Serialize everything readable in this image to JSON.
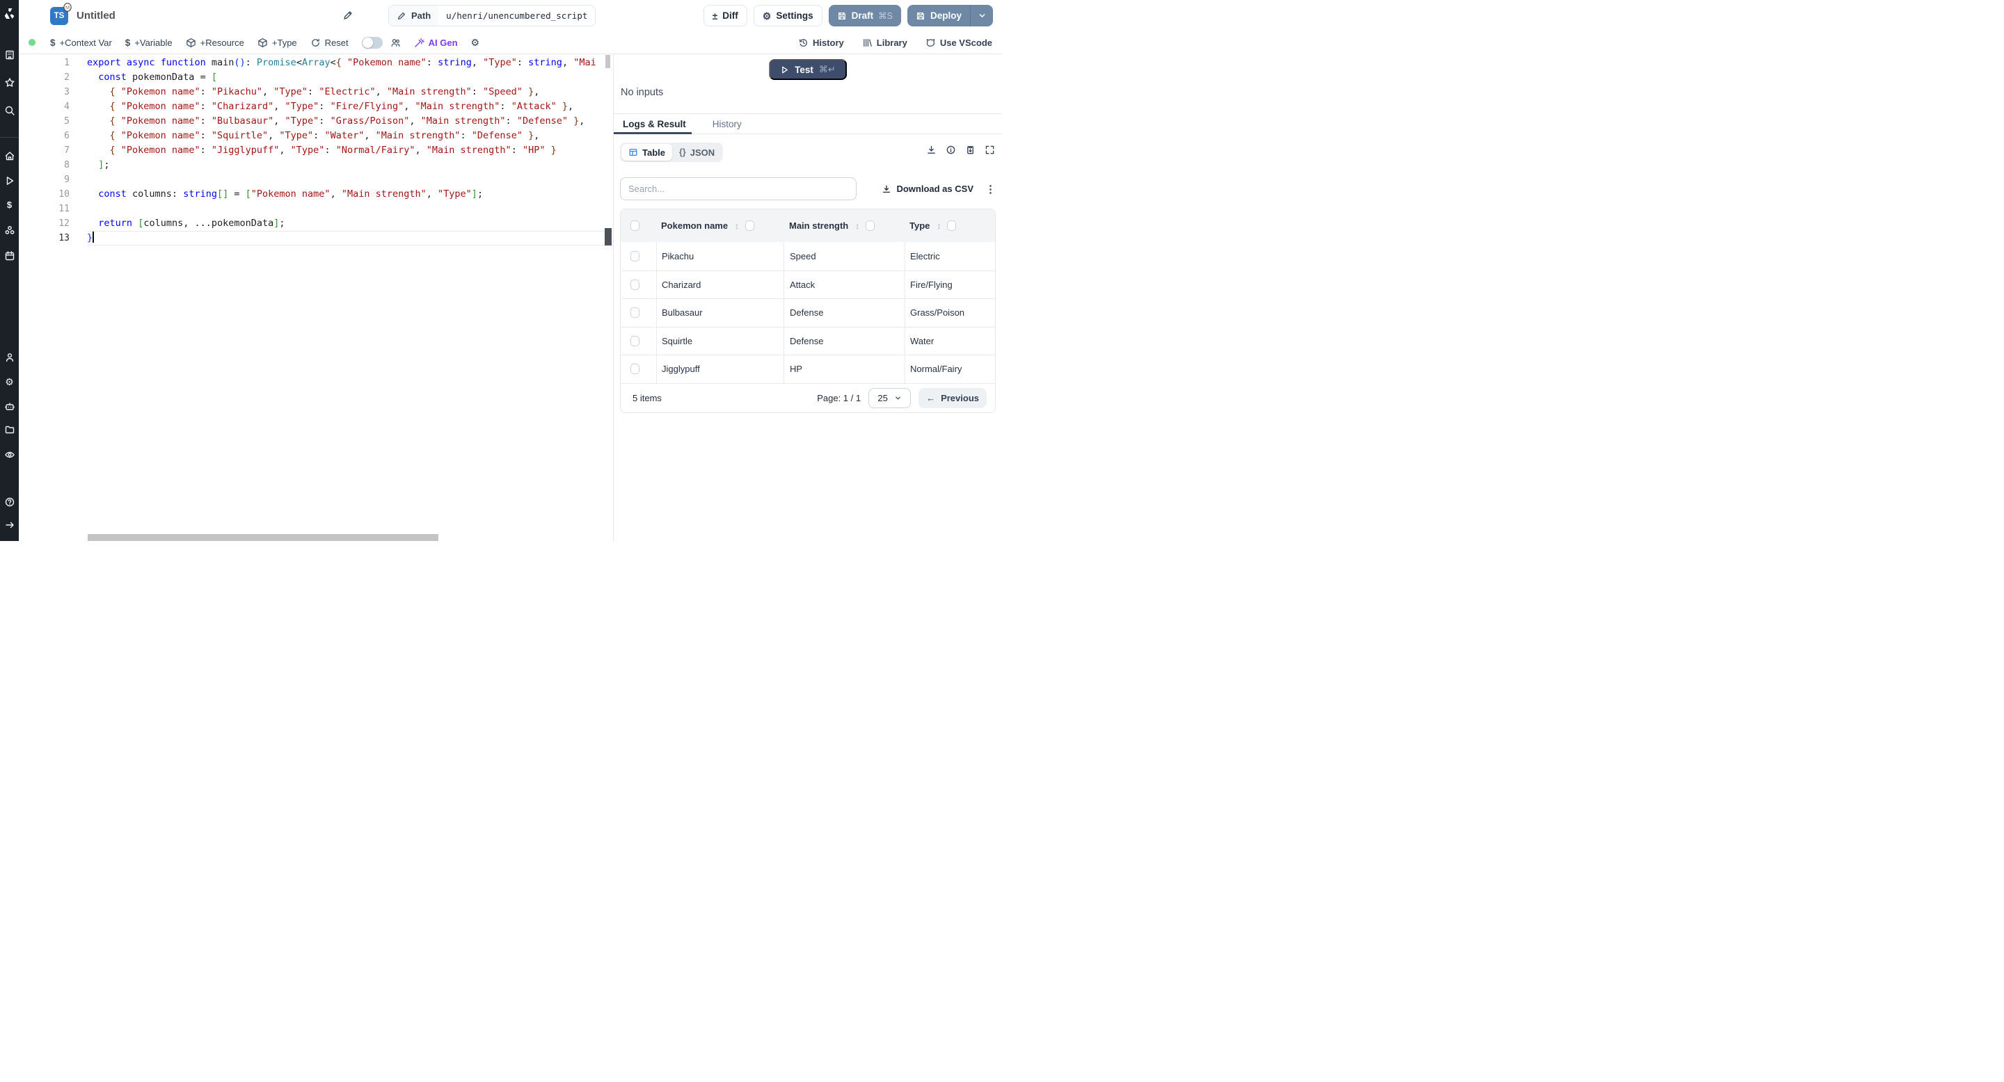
{
  "topbar": {
    "language_badge": "TS",
    "title": "Untitled",
    "path_label": "Path",
    "path_value": "u/henri/unencumbered_script",
    "diff_label": "Diff",
    "settings_label": "Settings",
    "draft_label": "Draft",
    "draft_kbd": "⌘S",
    "deploy_label": "Deploy"
  },
  "toolbar": {
    "context_var": "+Context Var",
    "variable": "+Variable",
    "resource": "+Resource",
    "type": "+Type",
    "reset": "Reset",
    "ai_gen": "AI Gen",
    "history": "History",
    "library": "Library",
    "vscode": "Use VScode"
  },
  "icons": {
    "diff_glyph": "±",
    "dollar_glyph": "$",
    "gear_glyph": "⚙",
    "sort_glyph": "↕",
    "kebab_glyph": "⋮",
    "prev_arrow_glyph": "←",
    "json_braces_glyph": "{}"
  },
  "sidebar": {
    "items": [
      "building",
      "star",
      "magnifier",
      "home",
      "play",
      "dollar",
      "cubes",
      "calendar",
      "user",
      "gear",
      "robot",
      "folder",
      "eye",
      "help",
      "arrow-right"
    ]
  },
  "editor": {
    "lines": [
      [
        [
          "k",
          "export"
        ],
        [
          "p",
          " "
        ],
        [
          "k",
          "async"
        ],
        [
          "p",
          " "
        ],
        [
          "k",
          "function"
        ],
        [
          "p",
          " main"
        ],
        [
          "b1",
          "()"
        ],
        [
          "p",
          ": "
        ],
        [
          "t",
          "Promise"
        ],
        [
          "p",
          "<"
        ],
        [
          "t",
          "Array"
        ],
        [
          "p",
          "<"
        ],
        [
          "b3",
          "{ "
        ],
        [
          "s",
          "\"Pokemon name\""
        ],
        [
          "p",
          ": "
        ],
        [
          "k",
          "string"
        ],
        [
          "p",
          ", "
        ],
        [
          "s",
          "\"Type\""
        ],
        [
          "p",
          ": "
        ],
        [
          "k",
          "string"
        ],
        [
          "p",
          ", "
        ],
        [
          "s",
          "\"Mai"
        ]
      ],
      [
        [
          "p",
          "  "
        ],
        [
          "k",
          "const"
        ],
        [
          "p",
          " pokemonData = "
        ],
        [
          "b2",
          "["
        ]
      ],
      [
        [
          "p",
          "    "
        ],
        [
          "b3",
          "{ "
        ],
        [
          "s",
          "\"Pokemon name\""
        ],
        [
          "p",
          ": "
        ],
        [
          "s",
          "\"Pikachu\""
        ],
        [
          "p",
          ", "
        ],
        [
          "s",
          "\"Type\""
        ],
        [
          "p",
          ": "
        ],
        [
          "s",
          "\"Electric\""
        ],
        [
          "p",
          ", "
        ],
        [
          "s",
          "\"Main strength\""
        ],
        [
          "p",
          ": "
        ],
        [
          "s",
          "\"Speed\""
        ],
        [
          "b3",
          " }"
        ],
        [
          "p",
          ","
        ]
      ],
      [
        [
          "p",
          "    "
        ],
        [
          "b3",
          "{ "
        ],
        [
          "s",
          "\"Pokemon name\""
        ],
        [
          "p",
          ": "
        ],
        [
          "s",
          "\"Charizard\""
        ],
        [
          "p",
          ", "
        ],
        [
          "s",
          "\"Type\""
        ],
        [
          "p",
          ": "
        ],
        [
          "s",
          "\"Fire/Flying\""
        ],
        [
          "p",
          ", "
        ],
        [
          "s",
          "\"Main strength\""
        ],
        [
          "p",
          ": "
        ],
        [
          "s",
          "\"Attack\""
        ],
        [
          "b3",
          " }"
        ],
        [
          "p",
          ","
        ]
      ],
      [
        [
          "p",
          "    "
        ],
        [
          "b3",
          "{ "
        ],
        [
          "s",
          "\"Pokemon name\""
        ],
        [
          "p",
          ": "
        ],
        [
          "s",
          "\"Bulbasaur\""
        ],
        [
          "p",
          ", "
        ],
        [
          "s",
          "\"Type\""
        ],
        [
          "p",
          ": "
        ],
        [
          "s",
          "\"Grass/Poison\""
        ],
        [
          "p",
          ", "
        ],
        [
          "s",
          "\"Main strength\""
        ],
        [
          "p",
          ": "
        ],
        [
          "s",
          "\"Defense\""
        ],
        [
          "b3",
          " }"
        ],
        [
          "p",
          ","
        ]
      ],
      [
        [
          "p",
          "    "
        ],
        [
          "b3",
          "{ "
        ],
        [
          "s",
          "\"Pokemon name\""
        ],
        [
          "p",
          ": "
        ],
        [
          "s",
          "\"Squirtle\""
        ],
        [
          "p",
          ", "
        ],
        [
          "s",
          "\"Type\""
        ],
        [
          "p",
          ": "
        ],
        [
          "s",
          "\"Water\""
        ],
        [
          "p",
          ", "
        ],
        [
          "s",
          "\"Main strength\""
        ],
        [
          "p",
          ": "
        ],
        [
          "s",
          "\"Defense\""
        ],
        [
          "b3",
          " }"
        ],
        [
          "p",
          ","
        ]
      ],
      [
        [
          "p",
          "    "
        ],
        [
          "b3",
          "{ "
        ],
        [
          "s",
          "\"Pokemon name\""
        ],
        [
          "p",
          ": "
        ],
        [
          "s",
          "\"Jigglypuff\""
        ],
        [
          "p",
          ", "
        ],
        [
          "s",
          "\"Type\""
        ],
        [
          "p",
          ": "
        ],
        [
          "s",
          "\"Normal/Fairy\""
        ],
        [
          "p",
          ", "
        ],
        [
          "s",
          "\"Main strength\""
        ],
        [
          "p",
          ": "
        ],
        [
          "s",
          "\"HP\""
        ],
        [
          "b3",
          " }"
        ]
      ],
      [
        [
          "p",
          "  "
        ],
        [
          "b2",
          "]"
        ],
        [
          "p",
          ";"
        ]
      ],
      [],
      [
        [
          "p",
          "  "
        ],
        [
          "k",
          "const"
        ],
        [
          "p",
          " columns: "
        ],
        [
          "k",
          "string"
        ],
        [
          "b2",
          "[]"
        ],
        [
          "p",
          " = "
        ],
        [
          "b2",
          "["
        ],
        [
          "s",
          "\"Pokemon name\""
        ],
        [
          "p",
          ", "
        ],
        [
          "s",
          "\"Main strength\""
        ],
        [
          "p",
          ", "
        ],
        [
          "s",
          "\"Type\""
        ],
        [
          "b2",
          "]"
        ],
        [
          "p",
          ";"
        ]
      ],
      [],
      [
        [
          "p",
          "  "
        ],
        [
          "k",
          "return"
        ],
        [
          "p",
          " "
        ],
        [
          "b2",
          "["
        ],
        [
          "p",
          "columns, ...pokemonData"
        ],
        [
          "b2",
          "]"
        ],
        [
          "p",
          ";"
        ]
      ],
      [
        [
          "b1",
          "}"
        ]
      ]
    ],
    "active_line": 13
  },
  "result_panel": {
    "test_label": "Test",
    "test_kbd": "⌘↵",
    "no_inputs": "No inputs",
    "tab_logs": "Logs & Result",
    "tab_history": "History",
    "view_table": "Table",
    "view_json": "JSON",
    "search_placeholder": "Search...",
    "download_csv": "Download as CSV",
    "table": {
      "columns": [
        "Pokemon name",
        "Main strength",
        "Type"
      ],
      "rows": [
        {
          "name": "Pikachu",
          "strength": "Speed",
          "type": "Electric"
        },
        {
          "name": "Charizard",
          "strength": "Attack",
          "type": "Fire/Flying"
        },
        {
          "name": "Bulbasaur",
          "strength": "Defense",
          "type": "Grass/Poison"
        },
        {
          "name": "Squirtle",
          "strength": "Defense",
          "type": "Water"
        },
        {
          "name": "Jigglypuff",
          "strength": "HP",
          "type": "Normal/Fairy"
        }
      ]
    },
    "footer": {
      "items_text": "5 items",
      "page_text": "Page: 1 / 1",
      "page_size": "25",
      "previous_label": "Previous"
    }
  },
  "colors": {
    "rail_bg": "#1c2027",
    "primary_button": "#6e88a6",
    "test_button": "#3e4d6b",
    "ts_badge": "#3178c6",
    "ai_gen": "#7c3aed",
    "live_dot": "#6fdd8b",
    "table_icon_blue": "#3b82f6",
    "tab_underline": "#3b4a65"
  }
}
